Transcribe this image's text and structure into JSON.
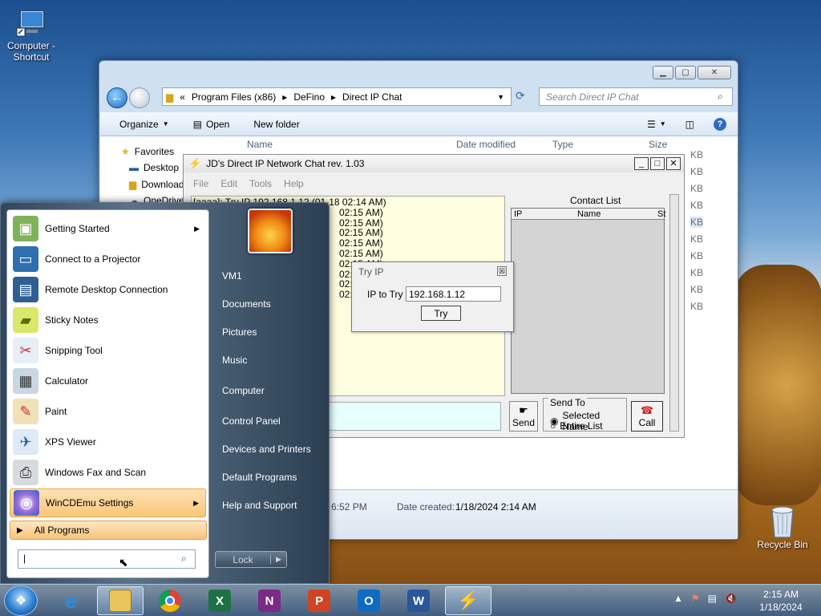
{
  "desktop": {
    "computer_icon_label": "Computer - Shortcut",
    "recycle_bin_label": "Recycle Bin"
  },
  "explorer": {
    "breadcrumb_prefix": "«",
    "breadcrumb": [
      "Program Files (x86)",
      "DeFino",
      "Direct IP Chat"
    ],
    "search_placeholder": "Search Direct IP Chat",
    "toolbar": {
      "organize": "Organize",
      "open": "Open",
      "new_folder": "New folder"
    },
    "columns": {
      "name": "Name",
      "date_modified": "Date modified",
      "type": "Type",
      "size": "Size"
    },
    "nav": [
      {
        "label": "Favorites"
      },
      {
        "label": "Desktop"
      },
      {
        "label": "Downloads"
      },
      {
        "label": "OneDrive"
      }
    ],
    "size_values": [
      "KB",
      "KB",
      "KB",
      "KB",
      "KB",
      "KB",
      "KB",
      "KB",
      "KB",
      "KB"
    ],
    "details": {
      "modified_fragment": "6:52 PM",
      "date_created_label": "Date created:",
      "date_created_value": "1/18/2024 2:14 AM"
    }
  },
  "chat": {
    "title": "JD's Direct IP Network Chat rev. 1.03",
    "menu": [
      "File",
      "Edit",
      "Tools",
      "Help"
    ],
    "log_first_line": "[aaaa]: Try IP 192.168.1.12 (01-18 02:14 AM)",
    "log_fragments": [
      "02:15 AM)",
      "02:15 AM)",
      "02:15 AM)",
      "02:15 AM)",
      "02:15 AM)",
      "02:15 AM)",
      "02:15 AM)",
      "02:15 AM)",
      "02:15 AM)"
    ],
    "contact_list_label": "Contact List",
    "contact_columns": {
      "ip": "IP",
      "name": "Name",
      "status": "St"
    },
    "send_label": "Send",
    "send_to_label": "Send To",
    "selected_name_label": "Selected Name",
    "entire_list_label": "Entire List",
    "call_label": "Call"
  },
  "try_ip_dialog": {
    "title": "Try IP",
    "close_symbol": "☒",
    "field_label": "IP to Try",
    "field_value": "192.168.1.12",
    "button_label": "Try"
  },
  "start_menu": {
    "programs": [
      {
        "label": "Getting Started",
        "icon": "getting-started-icon",
        "submenu": true
      },
      {
        "label": "Connect to a Projector",
        "icon": "projector-icon",
        "submenu": false
      },
      {
        "label": "Remote Desktop Connection",
        "icon": "remote-desktop-icon",
        "submenu": false
      },
      {
        "label": "Sticky Notes",
        "icon": "sticky-notes-icon",
        "submenu": false
      },
      {
        "label": "Snipping Tool",
        "icon": "snipping-tool-icon",
        "submenu": false
      },
      {
        "label": "Calculator",
        "icon": "calculator-icon",
        "submenu": false
      },
      {
        "label": "Paint",
        "icon": "paint-icon",
        "submenu": false
      },
      {
        "label": "XPS Viewer",
        "icon": "xps-viewer-icon",
        "submenu": false
      },
      {
        "label": "Windows Fax and Scan",
        "icon": "fax-scan-icon",
        "submenu": false
      },
      {
        "label": "WinCDEmu Settings",
        "icon": "wincdemu-icon",
        "submenu": true
      }
    ],
    "all_programs": "All Programs",
    "search_value": "|",
    "right_items": [
      "VM1",
      "Documents",
      "Pictures",
      "Music",
      "Computer",
      "Control Panel",
      "Devices and Printers",
      "Default Programs",
      "Help and Support"
    ],
    "lock_label": "Lock"
  },
  "taskbar": {
    "apps": [
      "internet-explorer-icon",
      "file-explorer-icon",
      "chrome-icon",
      "excel-icon",
      "onenote-icon",
      "powerpoint-icon",
      "outlook-icon",
      "word-icon",
      "direct-ip-chat-icon"
    ],
    "app_letters": {
      "excel": "X",
      "onenote": "N",
      "powerpoint": "P",
      "outlook": "O",
      "word": "W"
    },
    "clock_time": "2:15 AM",
    "clock_date": "1/18/2024"
  }
}
